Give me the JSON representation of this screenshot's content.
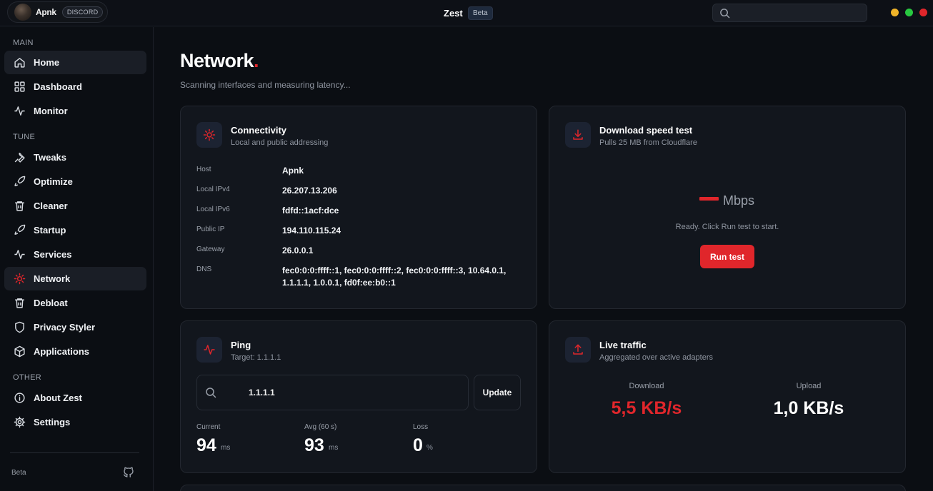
{
  "titlebar": {
    "user_name": "Apnk",
    "discord_label": "DISCORD",
    "app_name": "Zest",
    "beta_label": "Beta",
    "search_placeholder": "",
    "window_controls": [
      "#f0b429",
      "#28c840",
      "#e0262b"
    ]
  },
  "sidebar": {
    "sections": [
      {
        "label": "MAIN",
        "items": [
          {
            "label": "Home",
            "icon": "home-icon"
          },
          {
            "label": "Dashboard",
            "icon": "grid-icon"
          },
          {
            "label": "Monitor",
            "icon": "pulse-icon"
          }
        ]
      },
      {
        "label": "TUNE",
        "items": [
          {
            "label": "Tweaks",
            "icon": "wrench-icon"
          },
          {
            "label": "Optimize",
            "icon": "rocket-icon"
          },
          {
            "label": "Cleaner",
            "icon": "trash-icon"
          },
          {
            "label": "Startup",
            "icon": "rocket-icon"
          },
          {
            "label": "Services",
            "icon": "pulse-icon"
          },
          {
            "label": "Network",
            "icon": "sun-icon"
          },
          {
            "label": "Debloat",
            "icon": "trash-icon"
          },
          {
            "label": "Privacy Styler",
            "icon": "shield-icon"
          },
          {
            "label": "Applications",
            "icon": "box-icon"
          }
        ]
      },
      {
        "label": "OTHER",
        "items": [
          {
            "label": "About Zest",
            "icon": "info-icon"
          },
          {
            "label": "Settings",
            "icon": "gear-icon"
          }
        ]
      }
    ],
    "active_item": "Network",
    "footer_label": "Beta"
  },
  "page": {
    "title": "Network",
    "title_dot": ".",
    "subtitle": "Scanning interfaces and measuring latency..."
  },
  "connectivity": {
    "title": "Connectivity",
    "subtitle": "Local and public addressing",
    "rows": [
      {
        "key": "Host",
        "value": "Apnk"
      },
      {
        "key": "Local IPv4",
        "value": "26.207.13.206"
      },
      {
        "key": "Local IPv6",
        "value": "fdfd::1acf:dce"
      },
      {
        "key": "Public IP",
        "value": "194.110.115.24"
      },
      {
        "key": "Gateway",
        "value": "26.0.0.1"
      },
      {
        "key": "DNS",
        "value": "fec0:0:0:ffff::1, fec0:0:0:ffff::2, fec0:0:0:ffff::3, 10.64.0.1, 1.1.1.1, 1.0.0.1, fd0f:ee:b0::1"
      }
    ]
  },
  "speedtest": {
    "title": "Download speed test",
    "subtitle": "Pulls 25 MB from Cloudflare",
    "unit": "Mbps",
    "status": "Ready. Click Run test to start.",
    "button_label": "Run test"
  },
  "ping": {
    "title": "Ping",
    "subtitle": "Target: 1.1.1.1",
    "input_value": "1.1.1.1",
    "button_label": "Update",
    "stats": [
      {
        "label": "Current",
        "value": "94",
        "unit": "ms"
      },
      {
        "label": "Avg (60 s)",
        "value": "93",
        "unit": "ms"
      },
      {
        "label": "Loss",
        "value": "0",
        "unit": "%"
      }
    ]
  },
  "traffic": {
    "title": "Live traffic",
    "subtitle": "Aggregated over active adapters",
    "download_label": "Download",
    "download_value": "5,5 KB/s",
    "upload_label": "Upload",
    "upload_value": "1,0 KB/s"
  },
  "colors": {
    "accent": "#e0262b",
    "background": "#0b0e13",
    "card": "#12161d"
  }
}
